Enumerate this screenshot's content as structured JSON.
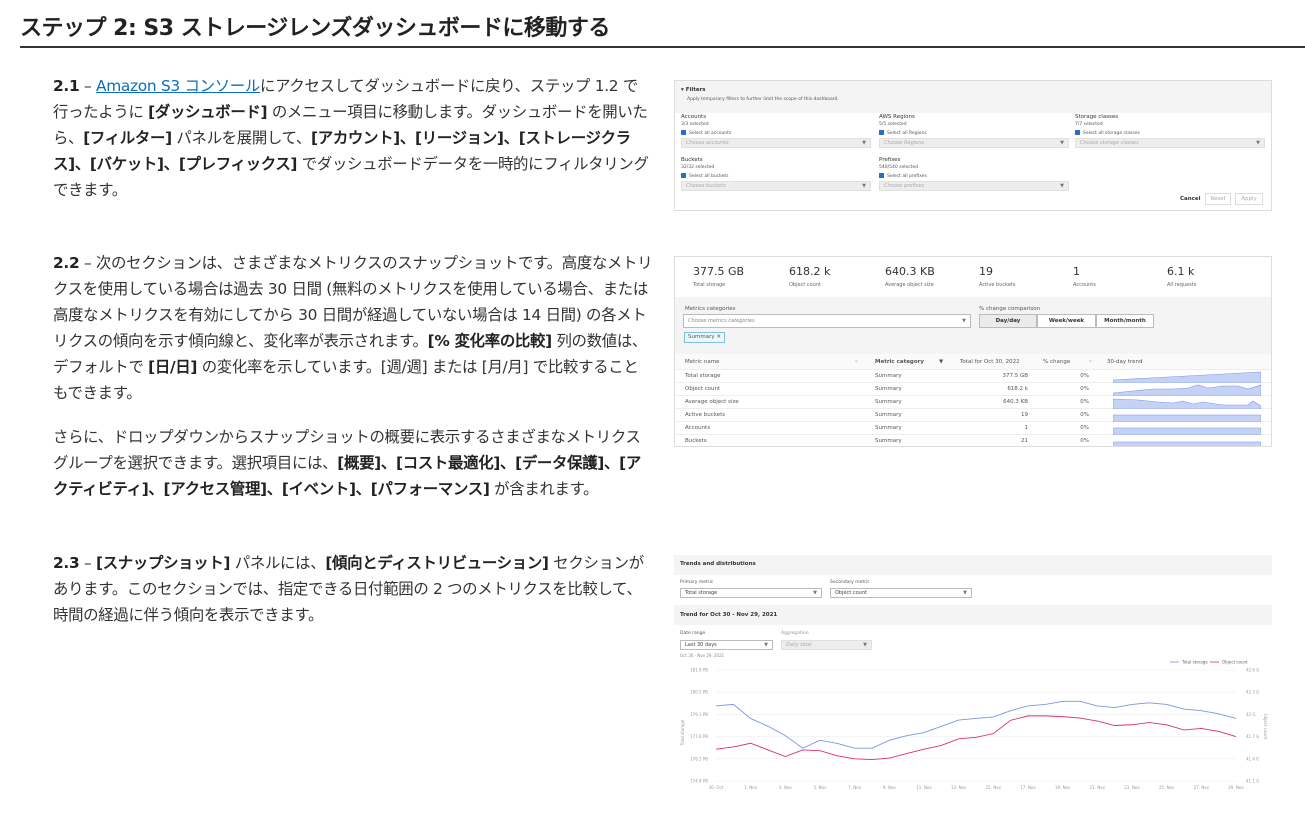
{
  "heading": "ステップ 2: S3 ストレージレンズダッシュボードに移動する",
  "p21": {
    "num": "2.1",
    "dash": " – ",
    "link": "Amazon S3 コンソール",
    "t1": "にアクセスしてダッシュボードに戻り、ステップ 1.2 で行ったように ",
    "b1": "[ダッシュボード]",
    "t2": " のメニュー項目に移動します。ダッシュボードを開いたら、",
    "b2": "[フィルター]",
    "t3": " パネルを展開して、",
    "b3": "[アカウント]、[リージョン]、[ストレージクラス]、[バケット]、[プレフィックス]",
    "t4": " でダッシュボードデータを一時的にフィルタリングできます。"
  },
  "p22": {
    "num": "2.2",
    "t1": " – 次のセクションは、さまざまなメトリクスのスナップショットです。高度なメトリクスを使用している場合は過去 30 日間 (無料のメトリクスを使用している場合、または高度なメトリクスを有効にしてから 30 日間が経過していない場合は 14 日間) の各メトリクスの傾向を示す傾向線と、変化率が表示されます。",
    "b1": "[% 変化率の比較]",
    "t2": " 列の数値は、デフォルトで ",
    "b2": "[日/日]",
    "t3": " の変化率を示しています。[週/週] または [月/月] で比較することもできます。"
  },
  "p22b": {
    "t1": "さらに、ドロップダウンからスナップショットの概要に表示するさまざまなメトリクスグループを選択できます。選択項目には、",
    "b1": "[概要]、[コスト最適化]、[データ保護]、[アクティビティ]、[アクセス管理]、[イベント]、[パフォーマンス]",
    "t2": " が含まれます。"
  },
  "p23": {
    "num": "2.3",
    "t1": " – ",
    "b1": "[スナップショット]",
    "t2": " パネルには、",
    "b2": "[傾向とディストリビューション]",
    "t3": " セクションがあります。このセクションでは、指定できる日付範囲の 2 つのメトリクスを比較して、時間の経過に伴う傾向を表示できます。"
  },
  "filters": {
    "title": "Filters",
    "subtitle": "Apply temporary filters to further limit the scope of this dashboard.",
    "groups": [
      {
        "label": "Accounts",
        "count": "3/3 selected",
        "check": "Select all accounts",
        "placeholder": "Choose accounts"
      },
      {
        "label": "AWS Regions",
        "count": "5/5 selected",
        "check": "Select all Regions",
        "placeholder": "Choose Regions"
      },
      {
        "label": "Storage classes",
        "count": "7/7 selected",
        "check": "Select all storage classes",
        "placeholder": "Choose storage classes"
      },
      {
        "label": "Buckets",
        "count": "32/32 selected",
        "check": "Select all buckets",
        "placeholder": "Choose buckets"
      },
      {
        "label": "Prefixes",
        "count": "540/540 selected",
        "check": "Select all prefixes",
        "placeholder": "Choose prefixes"
      }
    ],
    "cancel": "Cancel",
    "reset": "Reset",
    "apply": "Apply"
  },
  "snapshot": {
    "kpis": [
      {
        "value": "377.5 GB",
        "label": "Total storage"
      },
      {
        "value": "618.2 k",
        "label": "Object count"
      },
      {
        "value": "640.3 KB",
        "label": "Average object size"
      },
      {
        "value": "19",
        "label": "Active buckets"
      },
      {
        "value": "1",
        "label": "Accounts"
      },
      {
        "value": "6.1 k",
        "label": "All requests"
      }
    ],
    "categories_label": "Metrics categories",
    "categories_placeholder": "Choose metrics categories",
    "chip": "Summary",
    "compare_label": "% change comparison",
    "compare_options": [
      "Day/day",
      "Week/week",
      "Month/month"
    ],
    "columns": [
      "Metric name",
      "Metric category",
      "Total for Oct 30, 2022",
      "% change",
      "30-day trend"
    ],
    "rows": [
      {
        "name": "Total storage",
        "category": "Summary",
        "total": "377.5 GB",
        "change": "0%"
      },
      {
        "name": "Object count",
        "category": "Summary",
        "total": "618.2 k",
        "change": "0%"
      },
      {
        "name": "Average object size",
        "category": "Summary",
        "total": "640.3 KB",
        "change": "0%"
      },
      {
        "name": "Active buckets",
        "category": "Summary",
        "total": "19",
        "change": "0%"
      },
      {
        "name": "Accounts",
        "category": "Summary",
        "total": "1",
        "change": "0%"
      },
      {
        "name": "Buckets",
        "category": "Summary",
        "total": "21",
        "change": "0%"
      }
    ]
  },
  "trends": {
    "title": "Trends and distributions",
    "primary_label": "Primary metric",
    "primary_value": "Total storage",
    "secondary_label": "Secondary metric",
    "secondary_value": "Object count",
    "trend_title": "Trend for Oct 30 - Nov 29, 2021",
    "date_label": "Date range",
    "date_value": "Last 30 days",
    "agg_label": "Aggregation",
    "agg_value": "Daily total",
    "date_note": "Oct 30 - Nov 29, 2021"
  },
  "colors": {
    "primary": "#7b95e6",
    "secondary": "#d6336c",
    "link": "#0a6ebd"
  },
  "chart_data": {
    "type": "line",
    "xlabel": "",
    "ylabel": "Total storage",
    "y2label": "Object count",
    "x_ticks": [
      "30. Oct",
      "1. Nov",
      "3. Nov",
      "5. Nov",
      "7. Nov",
      "9. Nov",
      "11. Nov",
      "13. Nov",
      "15. Nov",
      "17. Nov",
      "19. Nov",
      "21. Nov",
      "23. Nov",
      "25. Nov",
      "27. Nov",
      "29. Nov"
    ],
    "y_ticks": [
      "174.8 PB",
      "176.2 PB",
      "177.6 PB",
      "179.1 PB",
      "180.5 PB",
      "181.9 PB"
    ],
    "y2_ticks": [
      "41.1 G",
      "41.4 G",
      "41.7 G",
      "42 G",
      "42.3 G",
      "42.6 G"
    ],
    "ylim": [
      174.8,
      181.9
    ],
    "y2lim": [
      41.1,
      42.6
    ],
    "legend": "top-right",
    "series": [
      {
        "name": "Total storage",
        "axis": "left",
        "values": [
          179.6,
          179.7,
          178.8,
          178.3,
          177.7,
          176.9,
          177.4,
          177.2,
          176.9,
          176.9,
          177.4,
          177.7,
          177.9,
          178.3,
          178.7,
          178.8,
          178.9,
          179.3,
          179.6,
          179.7,
          179.9,
          179.9,
          179.6,
          179.5,
          179.7,
          179.8,
          179.7,
          179.4,
          179.3,
          179.1,
          178.8
        ]
      },
      {
        "name": "Object count",
        "axis": "right",
        "values": [
          41.53,
          41.56,
          41.61,
          41.52,
          41.43,
          41.52,
          41.51,
          41.44,
          41.4,
          41.39,
          41.41,
          41.47,
          41.53,
          41.58,
          41.67,
          41.69,
          41.74,
          41.92,
          41.98,
          41.98,
          41.97,
          41.95,
          41.91,
          41.85,
          41.86,
          41.89,
          41.86,
          41.79,
          41.81,
          41.77,
          41.7
        ]
      }
    ]
  }
}
